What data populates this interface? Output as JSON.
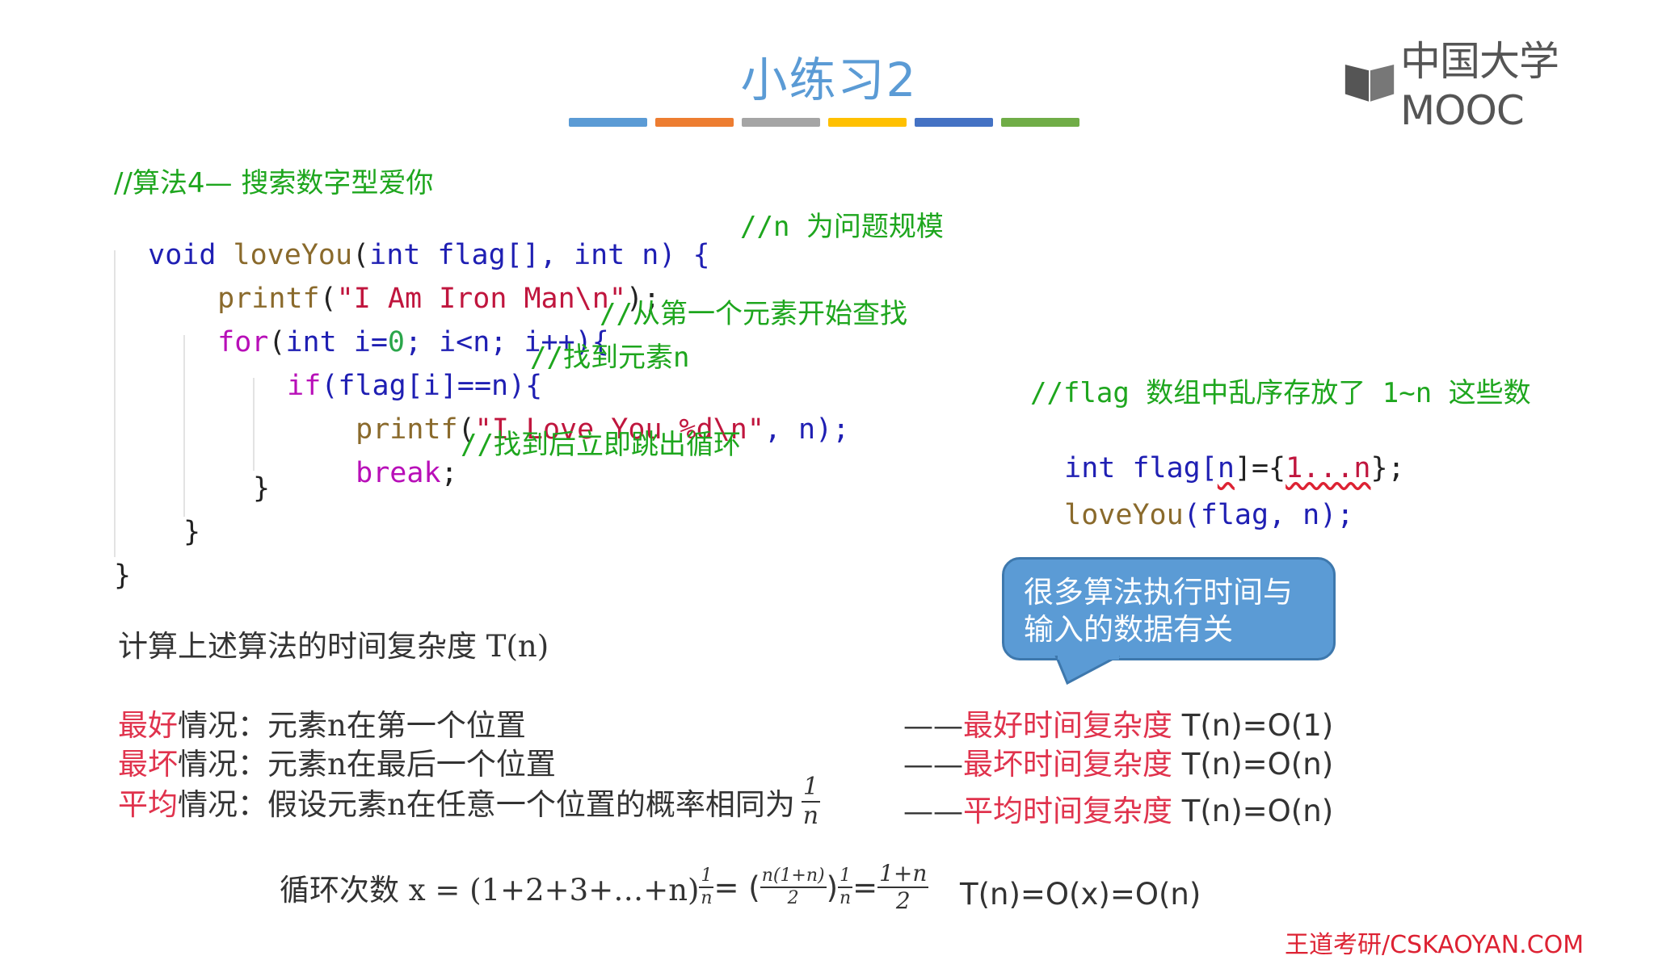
{
  "slide": {
    "title": "小练习2",
    "color_bar": [
      "#5b9bd5",
      "#ed7d31",
      "#a5a5a5",
      "#ffc000",
      "#4472c4",
      "#70ad47"
    ],
    "logo_text": "中国大学MOOC",
    "watermark": "王道考研/CSKAOYAN.COM"
  },
  "code": {
    "comment_header": "//算法4— 搜索数字型爱你",
    "l1_void": "void",
    "l1_fn": "loveYou",
    "l1_p1": "(",
    "l1_int1": "int",
    "l1_flag": " flag[], ",
    "l1_int2": "int",
    "l1_n": " n) {",
    "l1_cmt": "//n 为问题规模",
    "l2_fn": "printf",
    "l2_p1": "(",
    "l2_str": "\"I Am Iron Man\\n\"",
    "l2_end": ");",
    "l3_for": "for",
    "l3_p1": "(",
    "l3_int": "int",
    "l3_i": " i=",
    "l3_zero": "0",
    "l3_rest": "; i<n; i++){",
    "l3_cmt": "//从第一个元素开始查找",
    "l4_if": "if",
    "l4_rest": "(flag[i]==n){",
    "l4_cmt": "//找到元素n",
    "l5_fn": "printf",
    "l5_p1": "(",
    "l5_str": "\"I Love You %d\\n\"",
    "l5_end": ", n);",
    "l6_break": "break",
    "l6_semi": ";",
    "l6_cmt": "//找到后立即跳出循环",
    "l7": "}",
    "l8": "}",
    "l9": "}"
  },
  "side_code": {
    "comment": "//flag 数组中乱序存放了 1~n 这些数",
    "l2_int": "int",
    "l2_flag": " flag[",
    "l2_n": "n",
    "l2_eq": "]={",
    "l2_vals": "1...n",
    "l2_end": "};",
    "l3_fn": "loveYou",
    "l3_args": "(flag, n);"
  },
  "bubble": {
    "line1": "很多算法执行时间与",
    "line2": "输入的数据有关"
  },
  "question": "计算上述算法的时间复杂度 T(n)",
  "cases": [
    {
      "label": "最好",
      "suffix": "情况：",
      "desc": "元素n在第一个位置",
      "dash": "——",
      "result_red": "最好时间复杂度",
      "result": " T(n)=O(1)"
    },
    {
      "label": "最坏",
      "suffix": "情况：",
      "desc": "元素n在最后一个位置",
      "dash": "——",
      "result_red": "最坏时间复杂度",
      "result": " T(n)=O(n)"
    },
    {
      "label": "平均",
      "suffix": "情况：",
      "desc": "假设元素n在任意一个位置的概率相同为",
      "frac_num": "1",
      "frac_den": "n",
      "dash": "——",
      "result_red": "平均时间复杂度",
      "result": " T(n)=O(n)"
    }
  ],
  "formula": {
    "prefix": "循环次数 x = (1+2+3+…+n) ",
    "f1_num": "1",
    "f1_den": "n",
    "eq1": " = (",
    "f2_num": "n(1+n)",
    "f2_den": "2",
    "close": ")",
    "f3_num": "1",
    "f3_den": "n",
    "eq2": " = ",
    "f4_num": "1+n",
    "f4_den": "2",
    "result": "T(n)=O(x)=O(n)"
  }
}
